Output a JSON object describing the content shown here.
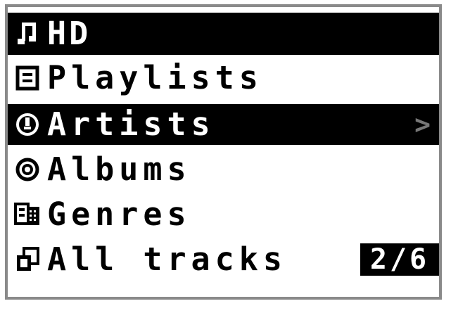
{
  "header": {
    "title": "HD",
    "icon": "music-note-icon"
  },
  "menu": {
    "items": [
      {
        "label": "Playlists",
        "icon": "playlist-icon"
      },
      {
        "label": "Artists",
        "icon": "artist-icon",
        "selected": true,
        "arrow": ">"
      },
      {
        "label": "Albums",
        "icon": "album-disc-icon"
      },
      {
        "label": "Genres",
        "icon": "genres-icon"
      },
      {
        "label": "All tracks",
        "icon": "all-tracks-icon"
      }
    ]
  },
  "position": {
    "counter": "2/6"
  },
  "colors": {
    "highlight": "#000000",
    "text": "#000000",
    "highlight_text": "#ffffff",
    "frame": "#8a8a8a"
  }
}
